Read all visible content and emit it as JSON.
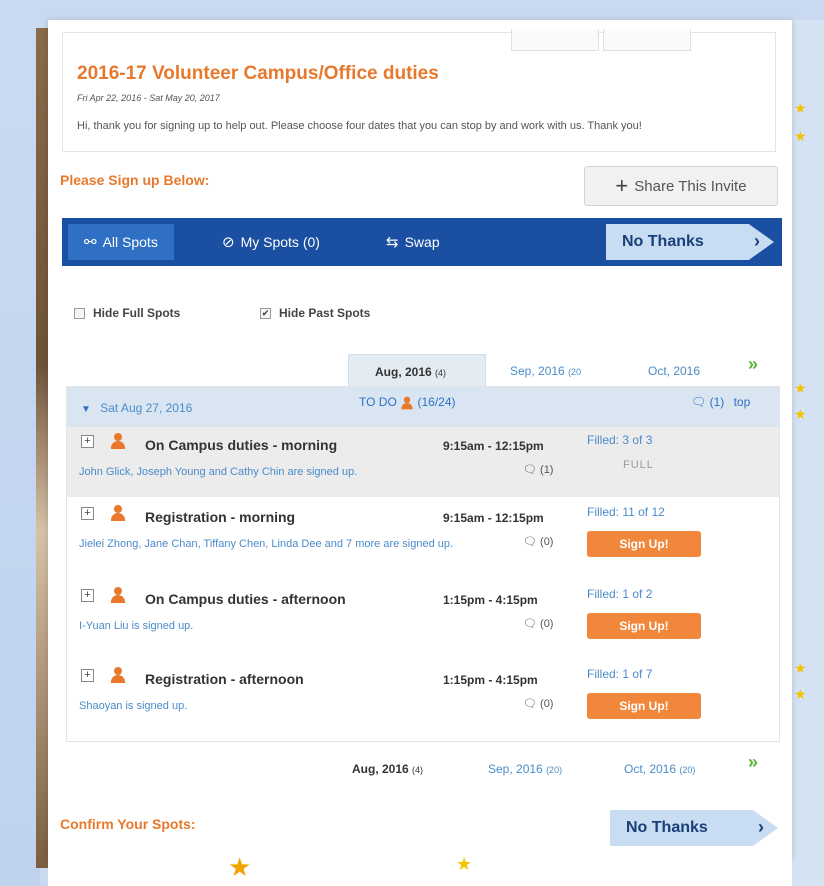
{
  "event": {
    "title": "2016-17 Volunteer Campus/Office duties",
    "dates": "Fri Apr 22, 2016 - Sat May 20, 2017",
    "description": "Hi, thank you for signing up to help out. Please choose four dates that you can stop by and work with us. Thank you!"
  },
  "signup_heading": "Please Sign up Below:",
  "share_label": "Share This Invite",
  "nav": {
    "all_spots": "All Spots",
    "my_spots": "My Spots (0)",
    "swap": "Swap",
    "no_thanks": "No Thanks"
  },
  "filters": {
    "hide_full": "Hide Full Spots",
    "hide_past": "Hide Past Spots"
  },
  "months_top": [
    {
      "label": "Aug, 2016",
      "count": "(4)"
    },
    {
      "label": "Sep, 2016",
      "count": "(20"
    },
    {
      "label": "Oct, 2016",
      "count": ""
    }
  ],
  "months_bottom": [
    {
      "label": "Aug, 2016",
      "count": "(4)"
    },
    {
      "label": "Sep, 2016",
      "count": "(20)"
    },
    {
      "label": "Oct, 2016",
      "count": "(20)"
    }
  ],
  "more_arrows": "»",
  "date_bar": {
    "date": "Sat Aug 27, 2016",
    "todo_label": "TO DO",
    "todo_count": "(16/24)",
    "comments": "(1)",
    "top": "top"
  },
  "slots": [
    {
      "title": "On Campus duties - morning",
      "time": "9:15am - 12:15pm",
      "names": "John Glick, Joseph Young and Cathy Chin are signed up.",
      "comments": "(1)",
      "filled": "Filled: 3 of 3",
      "status": "FULL",
      "signup": ""
    },
    {
      "title": "Registration - morning",
      "time": "9:15am - 12:15pm",
      "names": "Jielei Zhong, Jane Chan, Tiffany Chen, Linda Dee and 7 more are signed up.",
      "comments": "(0)",
      "filled": "Filled: 11 of 12",
      "status": "",
      "signup": "Sign Up!"
    },
    {
      "title": "On Campus duties - afternoon",
      "time": "1:15pm - 4:15pm",
      "names": "I-Yuan Liu is signed up.",
      "comments": "(0)",
      "filled": "Filled: 1 of 2",
      "status": "",
      "signup": "Sign Up!"
    },
    {
      "title": "Registration - afternoon",
      "time": "1:15pm - 4:15pm",
      "names": "Shaoyan is signed up.",
      "comments": "(0)",
      "filled": "Filled: 1 of 7",
      "status": "",
      "signup": "Sign Up!"
    }
  ],
  "confirm_heading": "Confirm Your Spots:",
  "confirm_no_thanks": "No Thanks",
  "colors": {
    "accent_orange": "#e8792c",
    "nav_blue": "#1b4fa1",
    "link_blue": "#4a8bc8"
  }
}
